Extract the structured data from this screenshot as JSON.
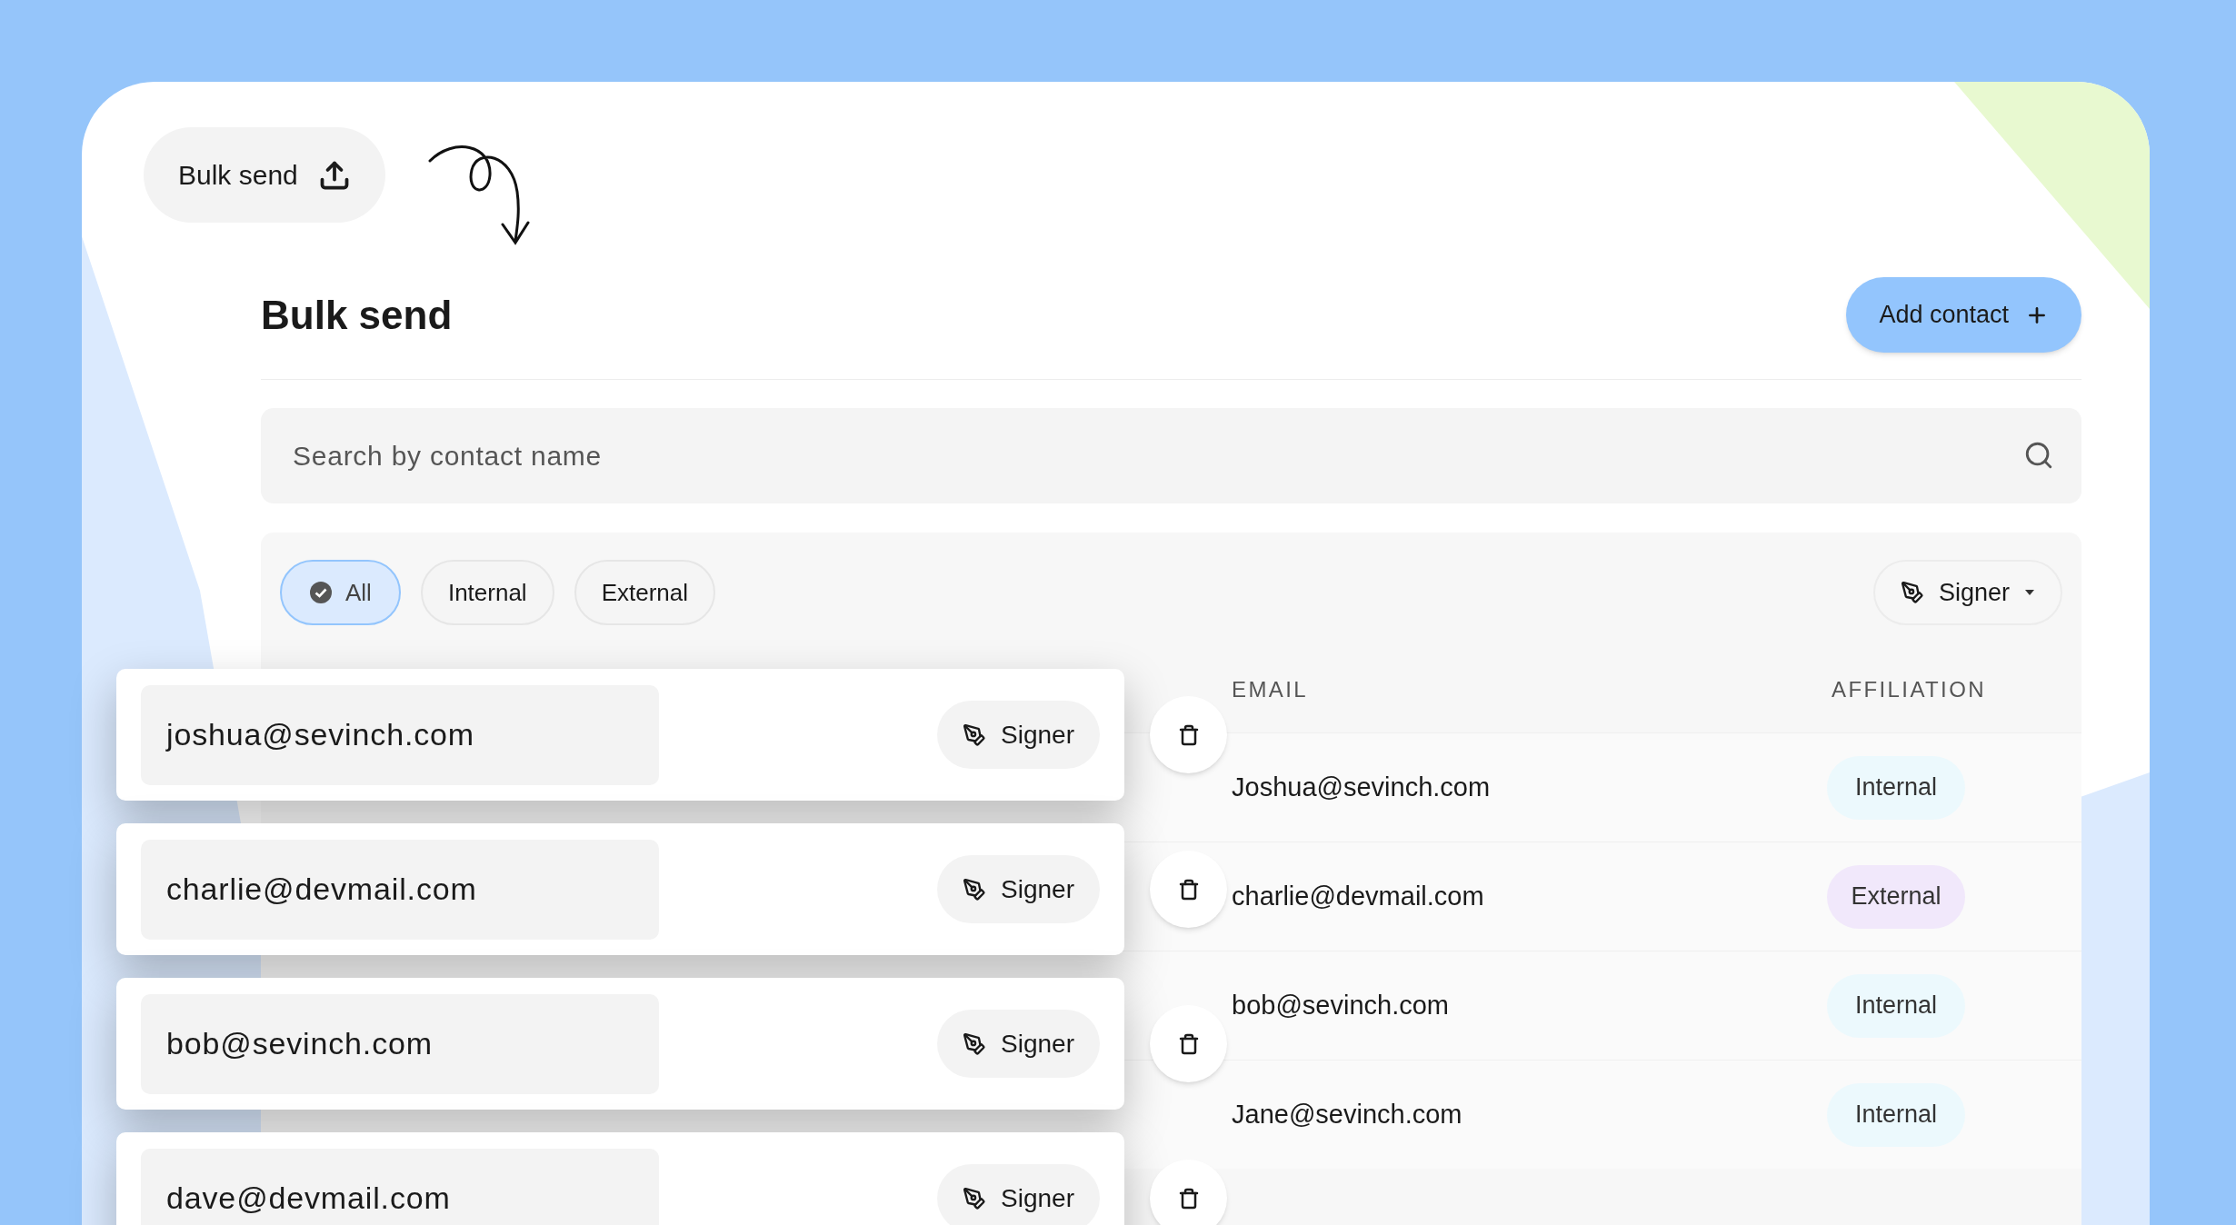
{
  "launcher": {
    "label": "Bulk send"
  },
  "page": {
    "title": "Bulk send",
    "add_button": "Add contact"
  },
  "search": {
    "placeholder": "Search by contact name"
  },
  "filters": [
    {
      "label": "All",
      "selected": true
    },
    {
      "label": "Internal",
      "selected": false
    },
    {
      "label": "External",
      "selected": false
    }
  ],
  "role_dropdown": {
    "label": "Signer"
  },
  "table": {
    "columns": [
      "EMAIL",
      "AFFILIATION"
    ],
    "rows": [
      {
        "email": "Joshua@sevinch.com",
        "affiliation": "Internal",
        "color": "#ecf9fd"
      },
      {
        "email": "charlie@devmail.com",
        "affiliation": "External",
        "color": "#f1e8fb"
      },
      {
        "email": "bob@sevinch.com",
        "affiliation": "Internal",
        "color": "#ecf9fd"
      },
      {
        "email": "Jane@sevinch.com",
        "affiliation": "Internal",
        "color": "#ecf9fd"
      }
    ]
  },
  "recipient_cards": [
    {
      "email": "joshua@sevinch.com",
      "role": "Signer"
    },
    {
      "email": "charlie@devmail.com",
      "role": "Signer"
    },
    {
      "email": "bob@sevinch.com",
      "role": "Signer"
    },
    {
      "email": "dave@devmail.com",
      "role": "Signer"
    }
  ]
}
